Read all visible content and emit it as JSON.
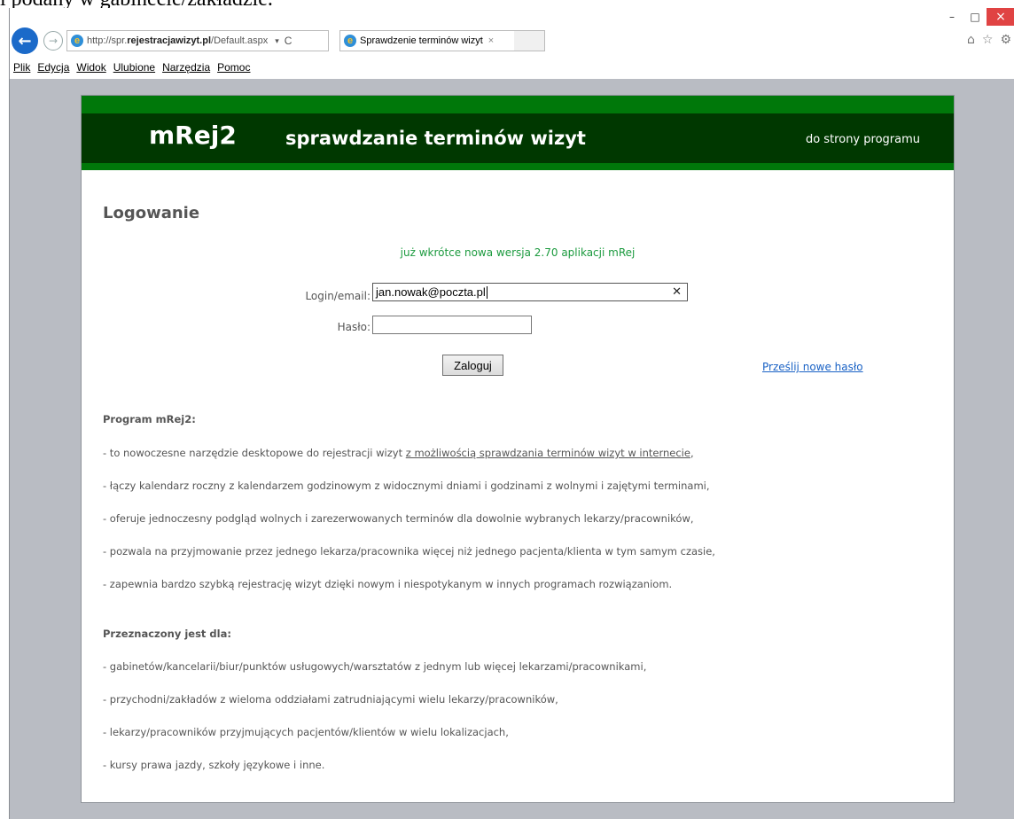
{
  "top_text": "i podany w gabinecie/zakładzie.",
  "window": {
    "minimize": "–",
    "maximize": "□",
    "close": "×"
  },
  "address_bar": {
    "url_prefix": "http://spr.",
    "url_domain": "rejestracjawizyt.pl",
    "url_path": "/Default.aspx",
    "dropdown": "▾",
    "refresh": "C"
  },
  "tab": {
    "title": "Sprawdzenie terminów wizyt",
    "close": "×"
  },
  "toolbar_icons": {
    "home": "⌂",
    "favorites": "☆",
    "settings": "⚙"
  },
  "menu": [
    "Plik",
    "Edycja",
    "Widok",
    "Ulubione",
    "Narzędzia",
    "Pomoc"
  ],
  "header": {
    "logo": "mRej2",
    "title": "sprawdzanie terminów wizyt",
    "link": "do strony programu"
  },
  "login": {
    "title": "Logowanie",
    "notice": "już wkrótce nowa wersja 2.70 aplikacji mRej",
    "login_label": "Login/email:",
    "login_value": "jan.nowak@poczta.pl",
    "password_label": "Hasło:",
    "submit": "Zaloguj",
    "reset_link": "Prześlij nowe hasło"
  },
  "program": {
    "heading": "Program mRej2:",
    "line1_prefix": "- to nowoczesne narzędzie desktopowe do rejestracji wizyt ",
    "line1_link": "z możliwością sprawdzania terminów wizyt w internecie",
    "line1_suffix": ",",
    "lines": [
      "- łączy kalendarz roczny z kalendarzem godzinowym z widocznymi dniami i godzinami z wolnymi i zajętymi terminami,",
      "- oferuje jednoczesny podgląd wolnych i zarezerwowanych terminów dla dowolnie wybranych lekarzy/pracowników,",
      "- pozwala na przyjmowanie przez jednego lekarza/pracownika więcej niż jednego pacjenta/klienta w tym samym czasie,",
      "- zapewnia bardzo szybką rejestrację wizyt dzięki nowym i niespotykanym w innych programach rozwiązaniom."
    ]
  },
  "audience": {
    "heading": "Przeznaczony jest dla:",
    "lines": [
      "- gabinetów/kancelarii/biur/punktów usługowych/warsztatów z jednym lub więcej lekarzami/pracownikami,",
      "- przychodni/zakładów z wieloma oddziałami zatrudniającymi wielu lekarzy/pracowników,",
      "- lekarzy/pracowników przyjmujących pacjentów/klientów w wielu lokalizacjach,",
      "- kursy prawa jazdy, szkoły językowe i inne."
    ]
  }
}
